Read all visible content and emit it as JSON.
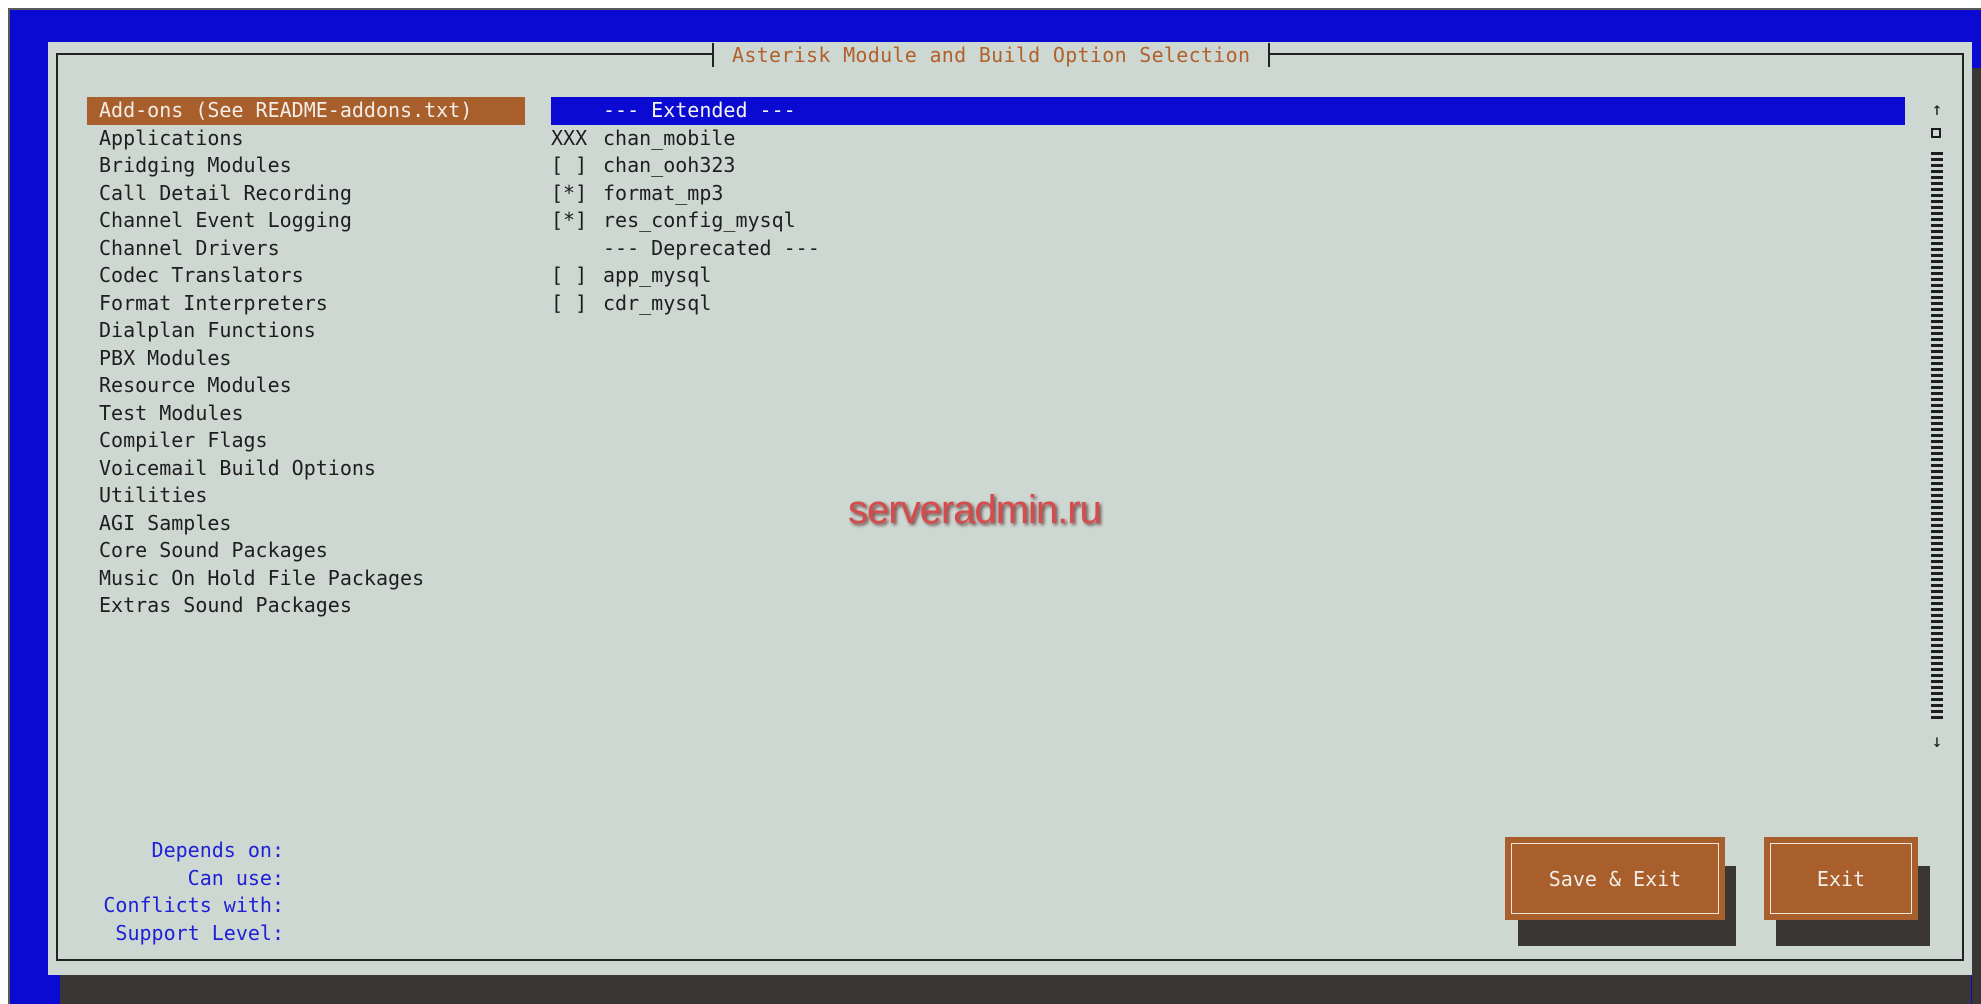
{
  "dialog": {
    "title": "Asterisk Module and Build Option Selection"
  },
  "categories": [
    {
      "label": "Add-ons (See README-addons.txt)",
      "selected": true
    },
    {
      "label": "Applications"
    },
    {
      "label": "Bridging Modules"
    },
    {
      "label": "Call Detail Recording"
    },
    {
      "label": "Channel Event Logging"
    },
    {
      "label": "Channel Drivers"
    },
    {
      "label": "Codec Translators"
    },
    {
      "label": "Format Interpreters"
    },
    {
      "label": "Dialplan Functions"
    },
    {
      "label": "PBX Modules"
    },
    {
      "label": "Resource Modules"
    },
    {
      "label": "Test Modules"
    },
    {
      "label": "Compiler Flags"
    },
    {
      "label": "Voicemail Build Options"
    },
    {
      "label": "Utilities"
    },
    {
      "label": "AGI Samples"
    },
    {
      "label": "Core Sound Packages"
    },
    {
      "label": "Music On Hold File Packages"
    },
    {
      "label": "Extras Sound Packages"
    }
  ],
  "options": [
    {
      "mark": "",
      "label": "--- Extended ---",
      "selected": true
    },
    {
      "mark": "XXX",
      "label": "chan_mobile"
    },
    {
      "mark": "[ ]",
      "label": "chan_ooh323"
    },
    {
      "mark": "[*]",
      "label": "format_mp3"
    },
    {
      "mark": "[*]",
      "label": "res_config_mysql"
    },
    {
      "mark": "",
      "label": "--- Deprecated ---"
    },
    {
      "mark": "[ ]",
      "label": "app_mysql"
    },
    {
      "mark": "[ ]",
      "label": "cdr_mysql"
    }
  ],
  "info": {
    "depends_on": "Depends on:",
    "can_use": "Can use:",
    "conflicts_with": "Conflicts with:",
    "support_level": "Support Level:"
  },
  "buttons": {
    "save_exit": "Save & Exit",
    "exit": "Exit"
  },
  "scrollbar": {
    "up_arrow": "↑",
    "down_arrow": "↓"
  },
  "watermark": "serveradmin.ru",
  "colors": {
    "screen_bg": "#0a0ad2",
    "dialog_bg": "#cdd8d2",
    "highlight_orange": "#a85f2c",
    "highlight_blue": "#0a0ad2",
    "info_text": "#2020d8",
    "title_text": "#b2602c"
  }
}
